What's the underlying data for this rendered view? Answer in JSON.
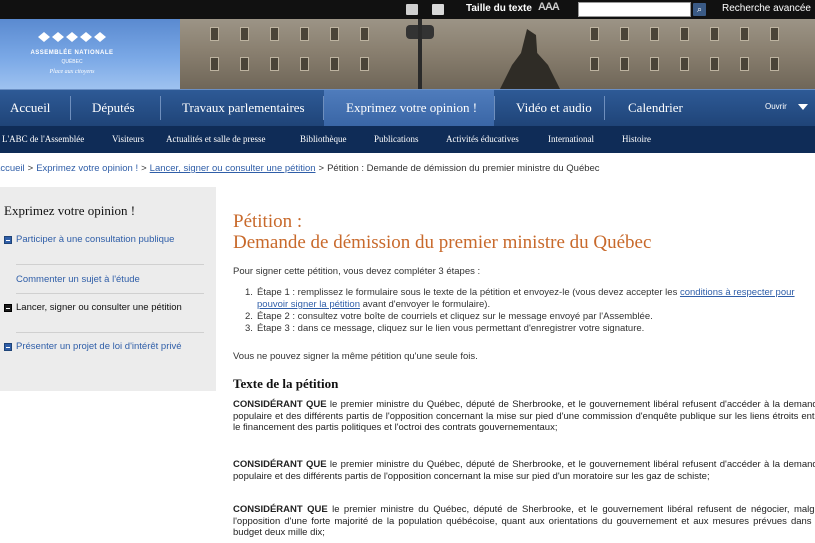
{
  "topbar": {
    "text_size_label": "Taille du texte",
    "text_size_glyph": "AAA",
    "search_placeholder": "",
    "search_button_glyph": "⌕",
    "advanced_search": "Recherche avancée"
  },
  "banner": {
    "logo_title": "ASSEMBLÉE NATIONALE",
    "logo_sub": "QUÉBEC",
    "logo_tagline": "Place aux citoyens"
  },
  "main_nav": {
    "items": [
      {
        "label": "Accueil"
      },
      {
        "label": "Députés"
      },
      {
        "label": "Travaux parlementaires"
      },
      {
        "label": "Exprimez votre opinion !"
      },
      {
        "label": "Vidéo et audio"
      },
      {
        "label": "Calendrier"
      }
    ],
    "open_label": "Ouvrir"
  },
  "sub_nav": {
    "items": [
      {
        "label": "L'ABC de l'Assemblée"
      },
      {
        "label": "Visiteurs"
      },
      {
        "label": "Actualités et salle de presse"
      },
      {
        "label": "Bibliothèque"
      },
      {
        "label": "Publications"
      },
      {
        "label": "Activités éducatives"
      },
      {
        "label": "International"
      },
      {
        "label": "Histoire"
      }
    ]
  },
  "breadcrumb": {
    "items": [
      "Accueil",
      "Exprimez votre opinion !",
      "Lancer, signer ou consulter une pétition"
    ],
    "current": "Pétition : Demande de démission du premier ministre du Québec",
    "separator": ">"
  },
  "sidebar": {
    "title": "Exprimez votre opinion !",
    "items": [
      {
        "label": "Participer à une consultation publique"
      },
      {
        "label": "Commenter un sujet à l'étude"
      },
      {
        "label": "Lancer, signer ou consulter une pétition"
      },
      {
        "label": "Présenter un projet de loi d'intérêt privé"
      }
    ]
  },
  "content": {
    "title_line1": "Pétition :",
    "title_line2": "Demande de démission du premier ministre du Québec",
    "intro": "Pour signer cette pétition, vous devez compléter 3 étapes :",
    "steps": [
      {
        "num": "1.",
        "before": "Étape 1 : remplissez le formulaire sous le texte de la pétition et envoyez-le (vous devez accepter les ",
        "link": "conditions à respecter pour pouvoir signer la pétition",
        "after": " avant d'envoyer le formulaire)."
      },
      {
        "num": "2.",
        "text": "Étape 2 : consultez votre boîte de courriels et cliquez sur le message envoyé par l'Assemblée."
      },
      {
        "num": "3.",
        "text": "Étape 3 : dans ce message, cliquez sur le lien vous permettant d'enregistrer votre signature."
      }
    ],
    "once_note": "Vous ne pouvez signer la même pétition qu'une seule fois.",
    "petition_heading": "Texte de la pétition",
    "paragraphs": [
      {
        "lead": "CONSIDÉRANT QUE",
        "text": " le premier ministre du Québec, député de Sherbrooke, et le gouvernement libéral refusent d'accéder à la demande populaire et des différents partis de l'opposition concernant la mise sur pied d'une commission d'enquête publique sur les liens étroits entre le financement des partis politiques et l'octroi des contrats gouvernementaux;"
      },
      {
        "lead": "CONSIDÉRANT QUE",
        "text": " le premier ministre du Québec, député de Sherbrooke, et le gouvernement libéral refusent d'accéder à la demande populaire et des différents partis de l'opposition concernant la mise sur pied d'un moratoire sur les gaz de schiste;"
      },
      {
        "lead": "CONSIDÉRANT QUE",
        "text": " le premier ministre du Québec, député de Sherbrooke, et le gouvernement libéral refusent de négocier, malgré l'opposition d'une forte majorité de la population québécoise, quant aux orientations du gouvernement et aux mesures prévues dans le budget deux mille dix;"
      }
    ]
  }
}
